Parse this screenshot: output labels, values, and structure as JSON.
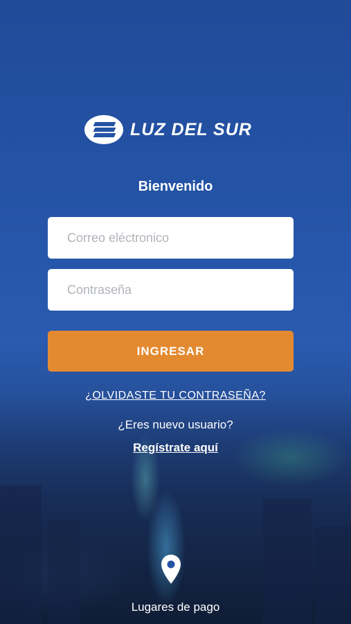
{
  "brand": {
    "name": "LUZ DEL SUR",
    "logo_icon": "luz-del-sur-logo-icon"
  },
  "login": {
    "title": "Bienvenido",
    "email_placeholder": "Correo eléctronico",
    "password_placeholder": "Contraseña",
    "submit_label": "INGRESAR",
    "forgot_password": "¿OLVIDASTE TU CONTRASEÑA?",
    "new_user_prompt": "¿Eres nuevo usuario?",
    "register_link": "Regístrate aquí"
  },
  "footer": {
    "payment_places_label": "Lugares de pago",
    "icon": "location-pin-icon"
  },
  "colors": {
    "accent": "#e38a31",
    "background": "#2453a6",
    "field": "#ffffff"
  }
}
